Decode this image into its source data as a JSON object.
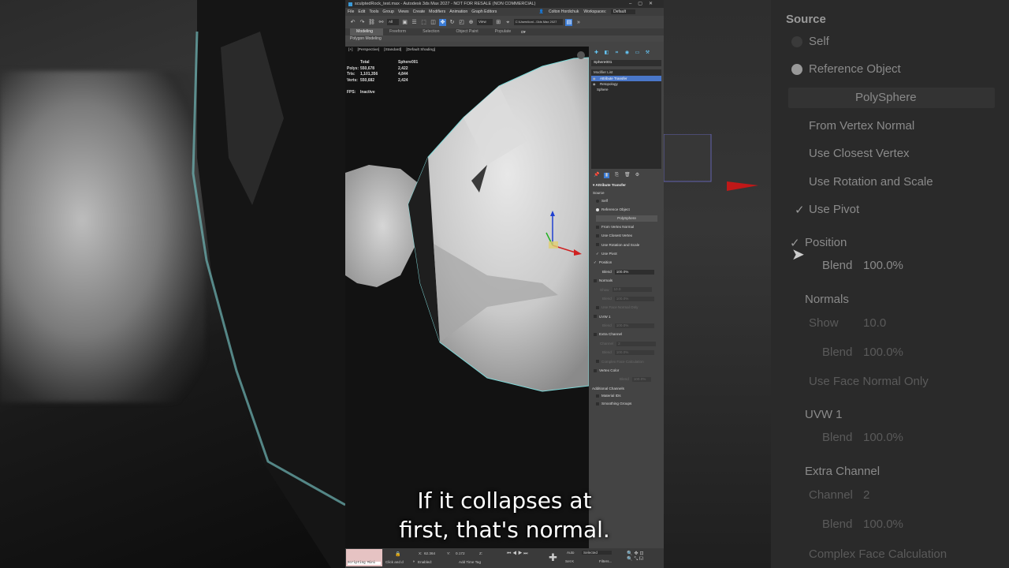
{
  "window": {
    "title": "sculptedRock_test.max - Autodesk 3ds Max 2027 - NOT FOR RESALE (NON COMMERCIAL)",
    "controls": "–▢✕"
  },
  "menu": {
    "items": [
      "File",
      "Edit",
      "Tools",
      "Group",
      "Views",
      "Create",
      "Modifiers",
      "Animation",
      "Graph Editors"
    ],
    "user": "Colton Hordichuk",
    "workspace_label": "Workspaces:",
    "workspace_value": "Default"
  },
  "toolbar": {
    "selection_filter": "All",
    "ref_coord": "View",
    "project_path": "C:\\Users\\tonl...\\3ds Max 2027"
  },
  "ribbon": {
    "tabs": [
      "Modeling",
      "Freeform",
      "Selection",
      "Object Paint",
      "Populate"
    ],
    "active_tab": "Modeling",
    "subpanel": "Polygon Modeling"
  },
  "viewport": {
    "labels": [
      "[+]",
      "[Perspective]",
      "[Standard]",
      "[Default Shading]"
    ],
    "stats": {
      "header_total": "Total",
      "header_object": "Sphere001",
      "rows": [
        {
          "label": "Polys:",
          "total": "550,678",
          "object": "2,422"
        },
        {
          "label": "Tris:",
          "total": "1,101,356",
          "object": "4,844"
        },
        {
          "label": "Verts:",
          "total": "550,682",
          "object": "2,424"
        }
      ],
      "fps_label": "FPS:",
      "fps_value": "Inactive"
    }
  },
  "command_panel": {
    "object_name": "Sphere001",
    "modifier_list": "Modifier List",
    "stack": [
      {
        "label": "Attribute Transfer",
        "selected": true
      },
      {
        "label": "Retopology",
        "selected": false
      },
      {
        "label": "Sphere",
        "selected": false
      }
    ],
    "rollout": {
      "title": "Attribute Transfer",
      "source_label": "Source",
      "self": "Self",
      "reference_object": "Reference Object",
      "pick_button": "PolySphere",
      "from_vertex_normal": "From Vertex Normal",
      "use_closest_vertex": "Use Closest Vertex",
      "use_rotation_scale": "Use Rotation and Scale",
      "use_pivot": "Use Pivot",
      "position": "Position",
      "blend_label": "Blend",
      "blend_value": "100.0%",
      "normals": "Normals",
      "show_label": "Show",
      "show_value": "10.0",
      "use_face_normal_only": "Use Face Normal Only",
      "uvw1": "UVW 1",
      "extra_channel": "Extra Channel",
      "channel_label": "Channel",
      "channel_value": "2",
      "complex_face_calc": "Complex Face Calculation",
      "vertex_color": "Vertex Color",
      "additional_channels": "Additional Channels",
      "material_ids": "Material IDs",
      "smoothing_groups": "Smoothing Groups"
    }
  },
  "statusbar": {
    "script_label": "Scripting Mini",
    "prompt": "Click and d",
    "x_label": "X:",
    "x_value": "62.364",
    "y_label": "Y:",
    "y_value": "0.172",
    "z_label": "Z:",
    "enabled": "Enabled:",
    "add_time_tag": "Add Time Tag",
    "auto": "Auto",
    "set_k": "Set K",
    "selected": "Selected",
    "filters": "Filters..."
  },
  "background_right": {
    "source": "Source",
    "self": "Self",
    "reference_object": "Reference Object",
    "pick": "PolySphere",
    "from_vertex_normal": "From Vertex Normal",
    "use_closest_vertex": "Use Closest Vertex",
    "use_rotation_scale": "Use Rotation and Scale",
    "use_pivot": "Use Pivot",
    "position": "Position",
    "blend": "Blend",
    "blend_value": "100.0%",
    "normals": "Normals",
    "show": "Show",
    "show_value": "10.0",
    "blend2_value": "100.0%",
    "use_face_normal_only": "Use Face Normal Only",
    "uvw1": "UVW 1",
    "blend3_value": "100.0%",
    "extra_channel": "Extra Channel",
    "channel": "Channel",
    "channel_value": "2",
    "blend4_value": "100.0%",
    "complex_face_calc": "Complex Face Calculation"
  },
  "subtitle": {
    "line1": "If it collapses at",
    "line2": "first, that's normal."
  },
  "colors": {
    "accent_blue": "#3a7bd5",
    "selection_outline": "#7fd8d8",
    "gizmo_red": "#d02020",
    "gizmo_blue": "#2040d0",
    "gizmo_green": "#20b020"
  }
}
